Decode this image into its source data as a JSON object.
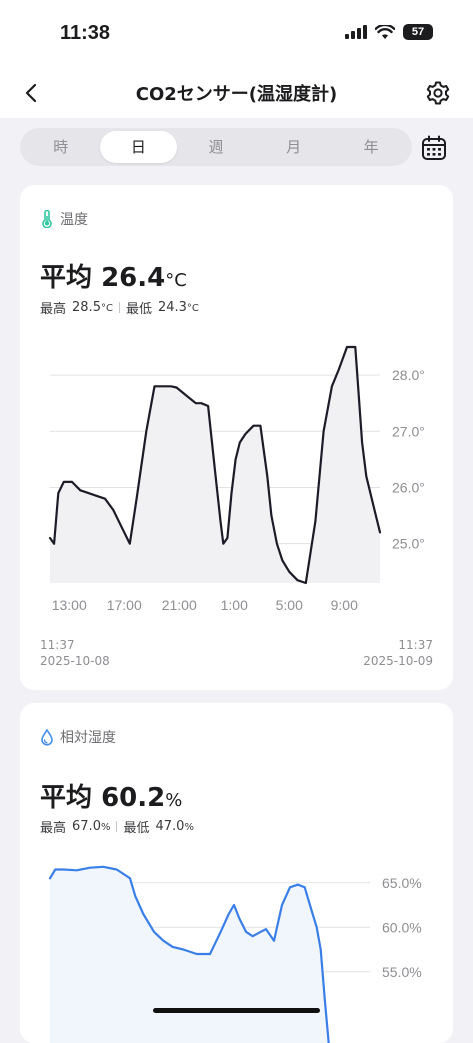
{
  "status_bar": {
    "time": "11:38",
    "battery": "57"
  },
  "nav": {
    "title": "CO2センサー(温湿度計)"
  },
  "period_tabs": [
    {
      "label": "時",
      "active": false
    },
    {
      "label": "日",
      "active": true
    },
    {
      "label": "週",
      "active": false
    },
    {
      "label": "月",
      "active": false
    },
    {
      "label": "年",
      "active": false
    }
  ],
  "temperature": {
    "title": "温度",
    "avg_prefix": "平均",
    "avg_value": "26.4",
    "unit": "°C",
    "max_label": "最高",
    "max_value": "28.5",
    "min_label": "最低",
    "min_value": "24.3",
    "start_time": "11:37",
    "start_date": "2025-10-08",
    "end_time": "11:37",
    "end_date": "2025-10-09"
  },
  "humidity": {
    "title": "相対湿度",
    "avg_prefix": "平均",
    "avg_value": "60.2",
    "unit": "%",
    "max_label": "最高",
    "max_value": "67.0",
    "min_label": "最低",
    "min_value": "47.0"
  },
  "chart_data": [
    {
      "type": "line",
      "title": "",
      "x_unit": "hours since start (11:37, 2025-10-08)",
      "xticks": [
        {
          "label": "13:00",
          "x": 1.4
        },
        {
          "label": "17:00",
          "x": 5.4
        },
        {
          "label": "21:00",
          "x": 9.4
        },
        {
          "label": "1:00",
          "x": 13.4
        },
        {
          "label": "5:00",
          "x": 17.4
        },
        {
          "label": "9:00",
          "x": 21.4
        }
      ],
      "yticks": [
        25.0,
        26.0,
        27.0,
        28.0
      ],
      "ytick_labels": [
        "25.0°",
        "26.0°",
        "27.0°",
        "28.0°"
      ],
      "ylim": [
        24.3,
        28.5
      ],
      "xlim": [
        0,
        24
      ],
      "series": [
        {
          "x": [
            0,
            0.3,
            0.6,
            1.0,
            1.6,
            2.2,
            2.8,
            3.4,
            4.0,
            4.6,
            5.2,
            5.8,
            6.3,
            7.0,
            7.6,
            8.2,
            8.8,
            9.2,
            9.6,
            10.1,
            10.6,
            11.0,
            11.5,
            12.0,
            12.4,
            12.6,
            12.9,
            13.2,
            13.5,
            13.8,
            14.2,
            14.8,
            15.3,
            15.8,
            16.1,
            16.5,
            16.9,
            17.4,
            18.0,
            18.6,
            19.3,
            19.9,
            20.5,
            21.0,
            21.6,
            22.2,
            22.7,
            23.0,
            23.3,
            23.6,
            24.0
          ],
          "y": [
            25.1,
            25.0,
            25.9,
            26.1,
            26.1,
            25.95,
            25.9,
            25.85,
            25.8,
            25.6,
            25.3,
            25.0,
            25.8,
            27.0,
            27.8,
            27.8,
            27.8,
            27.78,
            27.7,
            27.6,
            27.5,
            27.5,
            27.45,
            26.3,
            25.4,
            25.0,
            25.1,
            25.9,
            26.5,
            26.8,
            26.95,
            27.1,
            27.1,
            26.2,
            25.5,
            25.0,
            24.7,
            24.5,
            24.35,
            24.3,
            25.4,
            27.0,
            27.8,
            28.1,
            28.5,
            28.5,
            26.8,
            26.2,
            25.9,
            25.6,
            25.2
          ]
        }
      ]
    },
    {
      "type": "line",
      "title": "",
      "x_unit": "hours since start (11:37, 2025-10-08)",
      "yticks": [
        55.0,
        60.0,
        65.0
      ],
      "ytick_labels": [
        "55.0%",
        "60.0%",
        "65.0%"
      ],
      "ylim": [
        47.0,
        67.0
      ],
      "xlim": [
        0,
        24
      ],
      "series": [
        {
          "name": "",
          "x": [
            0,
            0.4,
            1.0,
            2.0,
            3.0,
            4.0,
            5.0,
            6.0,
            6.4,
            7.0,
            7.8,
            8.5,
            9.2,
            10.0,
            11.0,
            12.0,
            12.8,
            13.4,
            13.8,
            14.2,
            14.7,
            15.2,
            15.8,
            16.2,
            16.8,
            17.4,
            18.0,
            18.6,
            19.1,
            19.6,
            20.0,
            20.3,
            20.6,
            20.9
          ],
          "y": [
            65.5,
            66.5,
            66.5,
            66.4,
            66.7,
            66.8,
            66.5,
            65.5,
            63.5,
            61.5,
            59.5,
            58.5,
            57.8,
            57.5,
            57.0,
            57.0,
            59.5,
            61.5,
            62.5,
            61.0,
            59.5,
            59.0,
            59.5,
            59.8,
            58.5,
            62.5,
            64.5,
            64.8,
            64.5,
            62.0,
            60.0,
            57.5,
            52.0,
            47.0
          ]
        }
      ]
    }
  ]
}
